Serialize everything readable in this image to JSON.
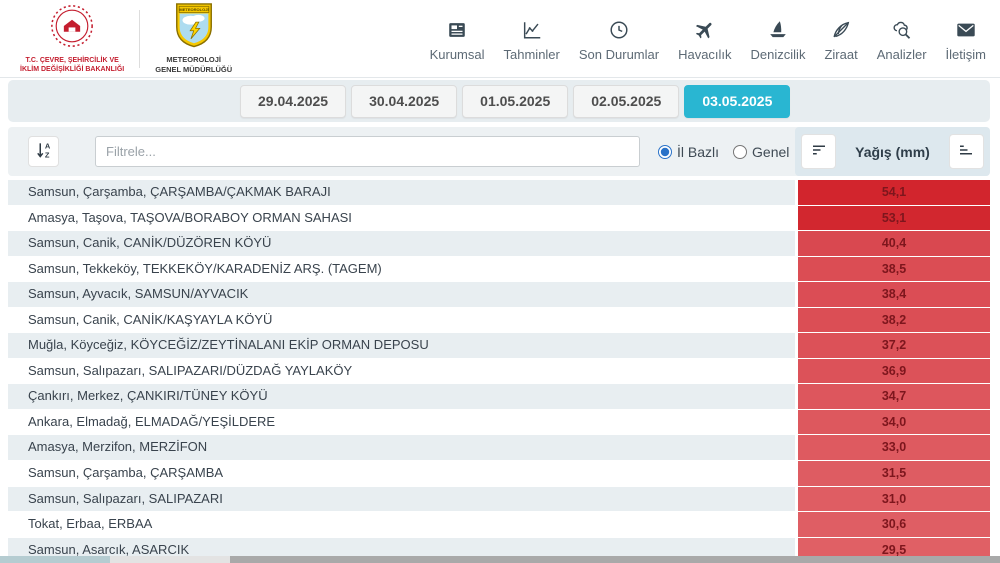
{
  "header": {
    "ministry": {
      "line1": "T.C. ÇEVRE, ŞEHİRCİLİK VE",
      "line2": "İKLİM DEĞİŞİKLİĞİ BAKANLIĞI"
    },
    "mgm": {
      "shield_text": "METEOROLOJİ",
      "line1": "METEOROLOJİ",
      "line2": "GENEL MÜDÜRLÜĞÜ"
    },
    "nav_items": [
      {
        "label": "Kurumsal",
        "icon": "newspaper-icon"
      },
      {
        "label": "Tahminler",
        "icon": "line-chart-icon"
      },
      {
        "label": "Son Durumlar",
        "icon": "clock-icon"
      },
      {
        "label": "Havacılık",
        "icon": "airplane-icon"
      },
      {
        "label": "Denizcilik",
        "icon": "sailboat-icon"
      },
      {
        "label": "Ziraat",
        "icon": "wheat-icon"
      },
      {
        "label": "Analizler",
        "icon": "search-cloud-icon"
      },
      {
        "label": "İletişim",
        "icon": "envelope-icon"
      }
    ]
  },
  "date_tabs": [
    {
      "label": "29.04.2025",
      "active": false
    },
    {
      "label": "30.04.2025",
      "active": false
    },
    {
      "label": "01.05.2025",
      "active": false
    },
    {
      "label": "02.05.2025",
      "active": false
    },
    {
      "label": "03.05.2025",
      "active": true
    }
  ],
  "filter": {
    "placeholder": "Filtrele...",
    "radio_options": [
      {
        "label": "İl Bazlı",
        "selected": true
      },
      {
        "label": "Genel",
        "selected": false
      }
    ]
  },
  "value_column": {
    "header": "Yağış (mm)"
  },
  "colors": {
    "accent_teal": "#29b6d2",
    "row_alt": "#e8eef1",
    "value_text": "#7d161d",
    "red_max": "#d2252d",
    "red_min": "#e06065"
  },
  "table": {
    "rows": [
      {
        "station": "Samsun, Çarşamba, ÇARŞAMBA/ÇAKMAK BARAJI",
        "value": "54,1",
        "bg": "#d2252d"
      },
      {
        "station": "Amasya, Taşova, TAŞOVA/BORABOY ORMAN SAHASI",
        "value": "53,1",
        "bg": "#d2272f"
      },
      {
        "station": "Samsun, Canik, CANİK/DÜZÖREN KÖYÜ",
        "value": "40,4",
        "bg": "#d94850"
      },
      {
        "station": "Samsun, Tekkeköy, TEKKEKÖY/KARADENİZ ARŞ. (TAGEM)",
        "value": "38,5",
        "bg": "#db4d54"
      },
      {
        "station": "Samsun, Ayvacık, SAMSUN/AYVACIK",
        "value": "38,4",
        "bg": "#db4d55"
      },
      {
        "station": "Samsun, Canik, CANİK/KAŞYAYLA KÖYÜ",
        "value": "38,2",
        "bg": "#db4e55"
      },
      {
        "station": "Muğla, Köyceğiz, KÖYCEĞİZ/ZEYTİNALANI EKİP ORMAN DEPOSU",
        "value": "37,2",
        "bg": "#dc5158"
      },
      {
        "station": "Samsun, Salıpazarı, SALIPAZARI/DÜZDAĞ YAYLAKÖY",
        "value": "36,9",
        "bg": "#dc5259"
      },
      {
        "station": "Çankırı, Merkez, ÇANKIRI/TÜNEY KÖYÜ",
        "value": "34,7",
        "bg": "#dd565d"
      },
      {
        "station": "Ankara, Elmadağ, ELMADAĞ/YEŞİLDERE",
        "value": "34,0",
        "bg": "#dd585e"
      },
      {
        "station": "Amasya, Merzifon, MERZİFON",
        "value": "33,0",
        "bg": "#de5a60"
      },
      {
        "station": "Samsun, Çarşamba, ÇARŞAMBA",
        "value": "31,5",
        "bg": "#de5c62"
      },
      {
        "station": "Samsun, Salıpazarı, SALIPAZARI",
        "value": "31,0",
        "bg": "#df5d63"
      },
      {
        "station": "Tokat, Erbaa, ERBAA",
        "value": "30,6",
        "bg": "#df5e64"
      },
      {
        "station": "Samsun, Asarcık, ASARCIK",
        "value": "29,5",
        "bg": "#e06065"
      }
    ]
  }
}
